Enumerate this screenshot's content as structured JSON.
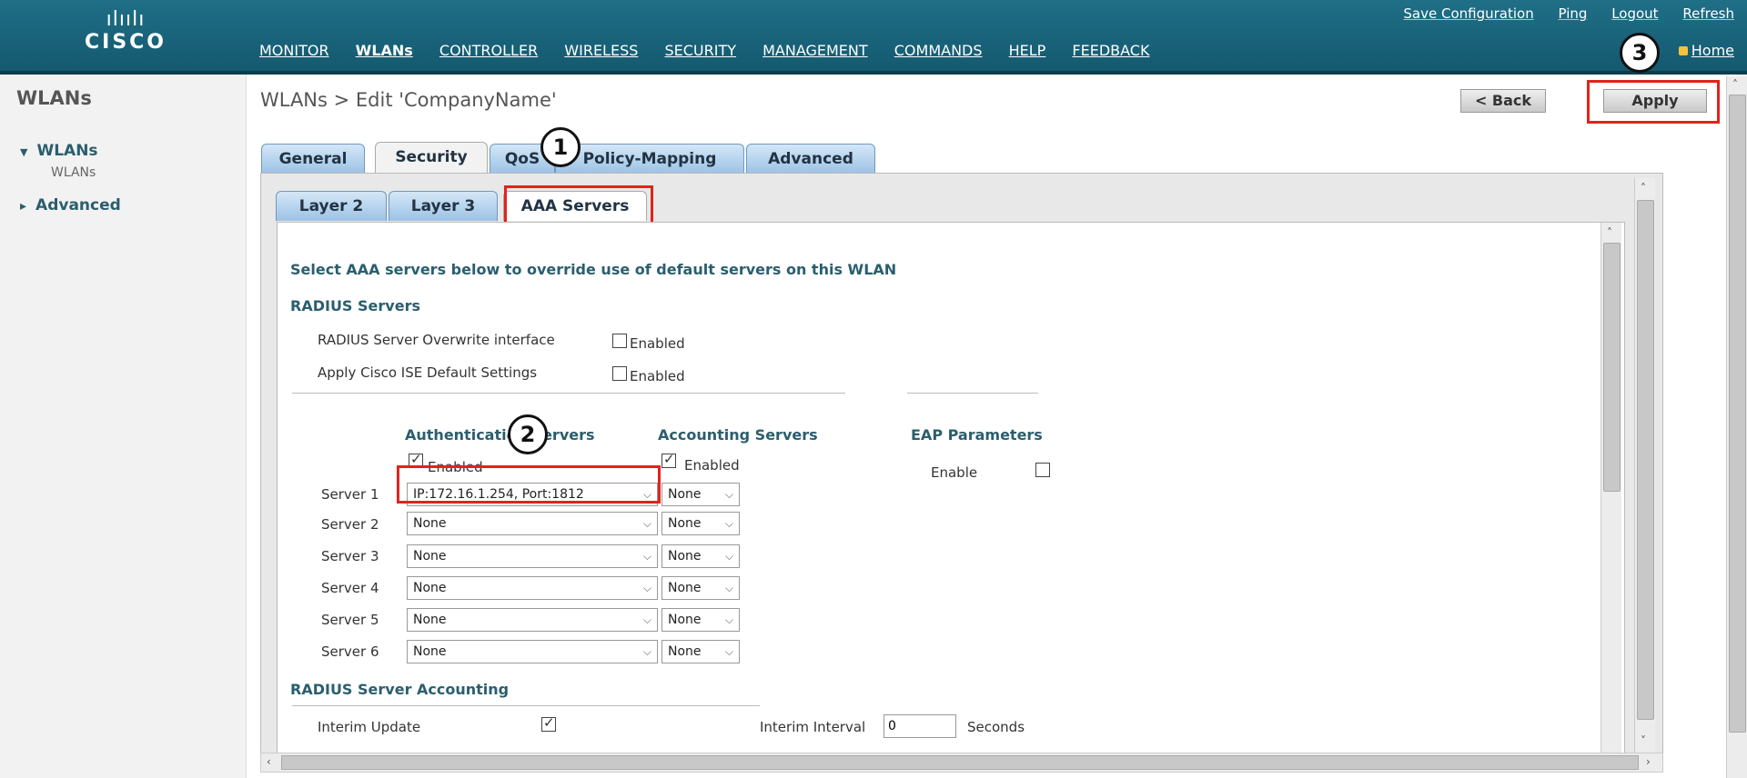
{
  "header": {
    "logo_bars": "ılıılı",
    "logo_text": "CISCO",
    "utility": [
      "Save Configuration",
      "Ping",
      "Logout",
      "Refresh"
    ],
    "nav": [
      "MONITOR",
      "WLANs",
      "CONTROLLER",
      "WIRELESS",
      "SECURITY",
      "MANAGEMENT",
      "COMMANDS",
      "HELP",
      "FEEDBACK"
    ],
    "home": "Home"
  },
  "sidebar": {
    "title": "WLANs",
    "items": [
      {
        "label": "WLANs",
        "expanded": true
      },
      {
        "label": "WLANs",
        "sub": true
      },
      {
        "label": "Advanced",
        "expanded": false
      }
    ],
    "arrow_down": "▼",
    "arrow_right": "▸"
  },
  "page": {
    "title": "WLANs > Edit  'CompanyName'",
    "back": "< Back",
    "apply": "Apply"
  },
  "tabs": [
    "General",
    "Security",
    "QoS",
    "Policy-Mapping",
    "Advanced"
  ],
  "subtabs": [
    "Layer 2",
    "Layer 3",
    "AAA Servers"
  ],
  "aaa": {
    "intro": "Select AAA servers below to override use of default servers on this WLAN",
    "radius_header": "RADIUS Servers",
    "overwrite_label": "RADIUS Server Overwrite interface",
    "ise_label": "Apply Cisco ISE Default Settings",
    "enabled": "Enabled",
    "auth_header": "Authentication Servers",
    "acct_header": "Accounting Servers",
    "eap_header": "EAP Parameters",
    "eap_enable": "Enable",
    "servers": [
      {
        "label": "Server 1",
        "auth": "IP:172.16.1.254, Port:1812",
        "acct": "None"
      },
      {
        "label": "Server 2",
        "auth": "None",
        "acct": "None"
      },
      {
        "label": "Server 3",
        "auth": "None",
        "acct": "None"
      },
      {
        "label": "Server 4",
        "auth": "None",
        "acct": "None"
      },
      {
        "label": "Server 5",
        "auth": "None",
        "acct": "None"
      },
      {
        "label": "Server 6",
        "auth": "None",
        "acct": "None"
      }
    ],
    "accounting_header": "RADIUS Server Accounting",
    "interim_update": "Interim Update",
    "interim_interval": "Interim Interval",
    "interim_value": "0",
    "seconds": "Seconds"
  },
  "callouts": [
    "1",
    "2",
    "3"
  ],
  "colors": {
    "header": "#1f6f87",
    "callout_red": "#e2231a",
    "link_teal": "#2b5e6e"
  }
}
